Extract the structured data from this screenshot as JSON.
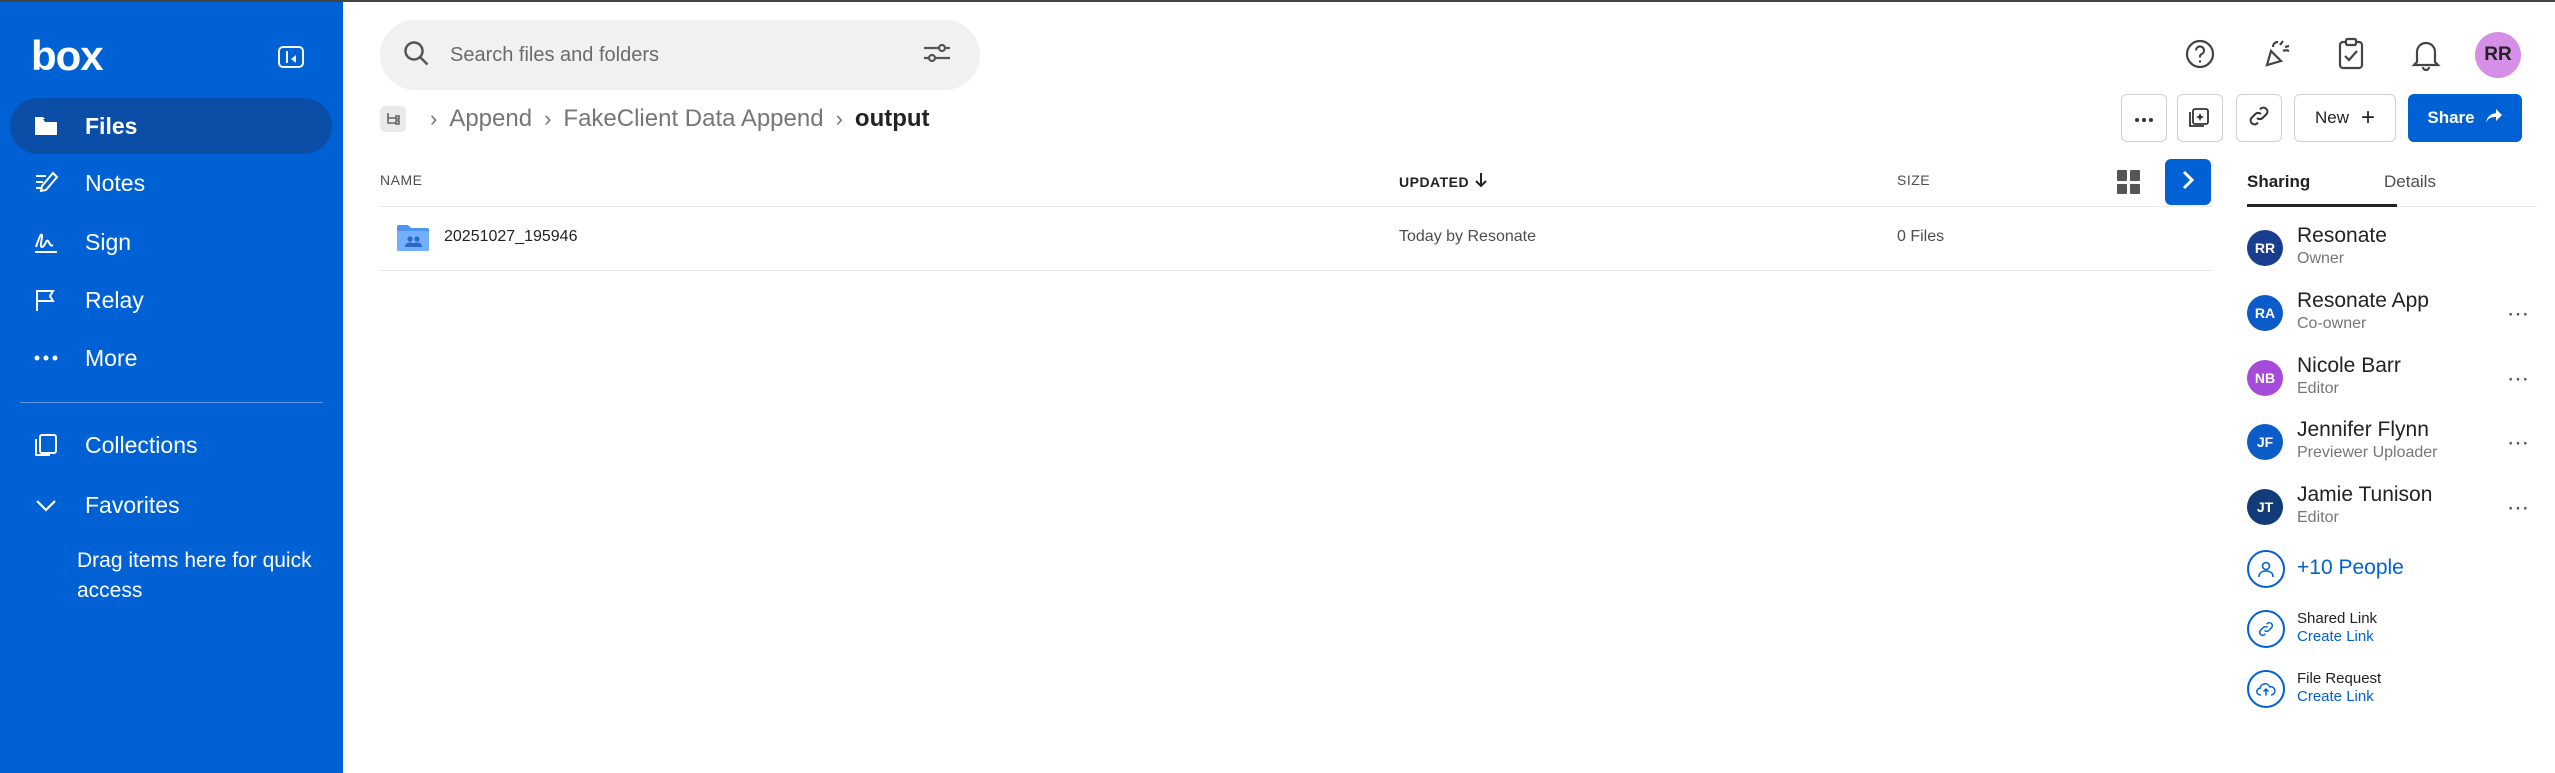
{
  "app": {
    "logo": "box"
  },
  "sidebar": {
    "items": [
      {
        "label": "Files",
        "icon": "folder-icon",
        "active": true
      },
      {
        "label": "Notes",
        "icon": "notes-icon"
      },
      {
        "label": "Sign",
        "icon": "sign-icon"
      },
      {
        "label": "Relay",
        "icon": "relay-icon"
      },
      {
        "label": "More",
        "icon": "more-dots-icon"
      },
      {
        "label": "Collections",
        "icon": "collections-icon"
      },
      {
        "label": "Favorites",
        "icon": "chevron-down-icon"
      }
    ],
    "favorites_hint": "Drag items here for quick access"
  },
  "search": {
    "placeholder": "Search files and folders"
  },
  "header": {
    "avatar_initials": "RR"
  },
  "breadcrumb": {
    "items": [
      "Append",
      "FakeClient Data Append"
    ],
    "current": "output"
  },
  "toolbar": {
    "new_label": "New",
    "share_label": "Share"
  },
  "table": {
    "columns": {
      "name": "NAME",
      "updated": "UPDATED",
      "size": "SIZE"
    },
    "rows": [
      {
        "name": "20251027_195946",
        "updated": "Today by Resonate",
        "size": "0 Files"
      }
    ]
  },
  "panel": {
    "tabs": [
      "Sharing",
      "Details"
    ],
    "people": [
      {
        "initials": "RR",
        "name": "Resonate",
        "role": "Owner",
        "color": "#1a3d8f"
      },
      {
        "initials": "RA",
        "name": "Resonate App",
        "role": "Co-owner",
        "color": "#0b5cc9"
      },
      {
        "initials": "NB",
        "name": "Nicole Barr",
        "role": "Editor",
        "color": "#a64ad9"
      },
      {
        "initials": "JF",
        "name": "Jennifer Flynn",
        "role": "Previewer Uploader",
        "color": "#0b5cc9"
      },
      {
        "initials": "JT",
        "name": "Jamie Tunison",
        "role": "Editor",
        "color": "#123b7a"
      }
    ],
    "more_people": "+10 People",
    "shared_link": {
      "title": "Shared Link",
      "action": "Create Link"
    },
    "file_request": {
      "title": "File Request",
      "action": "Create Link"
    }
  },
  "colors": {
    "brand": "#0061d5",
    "sidebar_active": "#0a4ea8"
  }
}
